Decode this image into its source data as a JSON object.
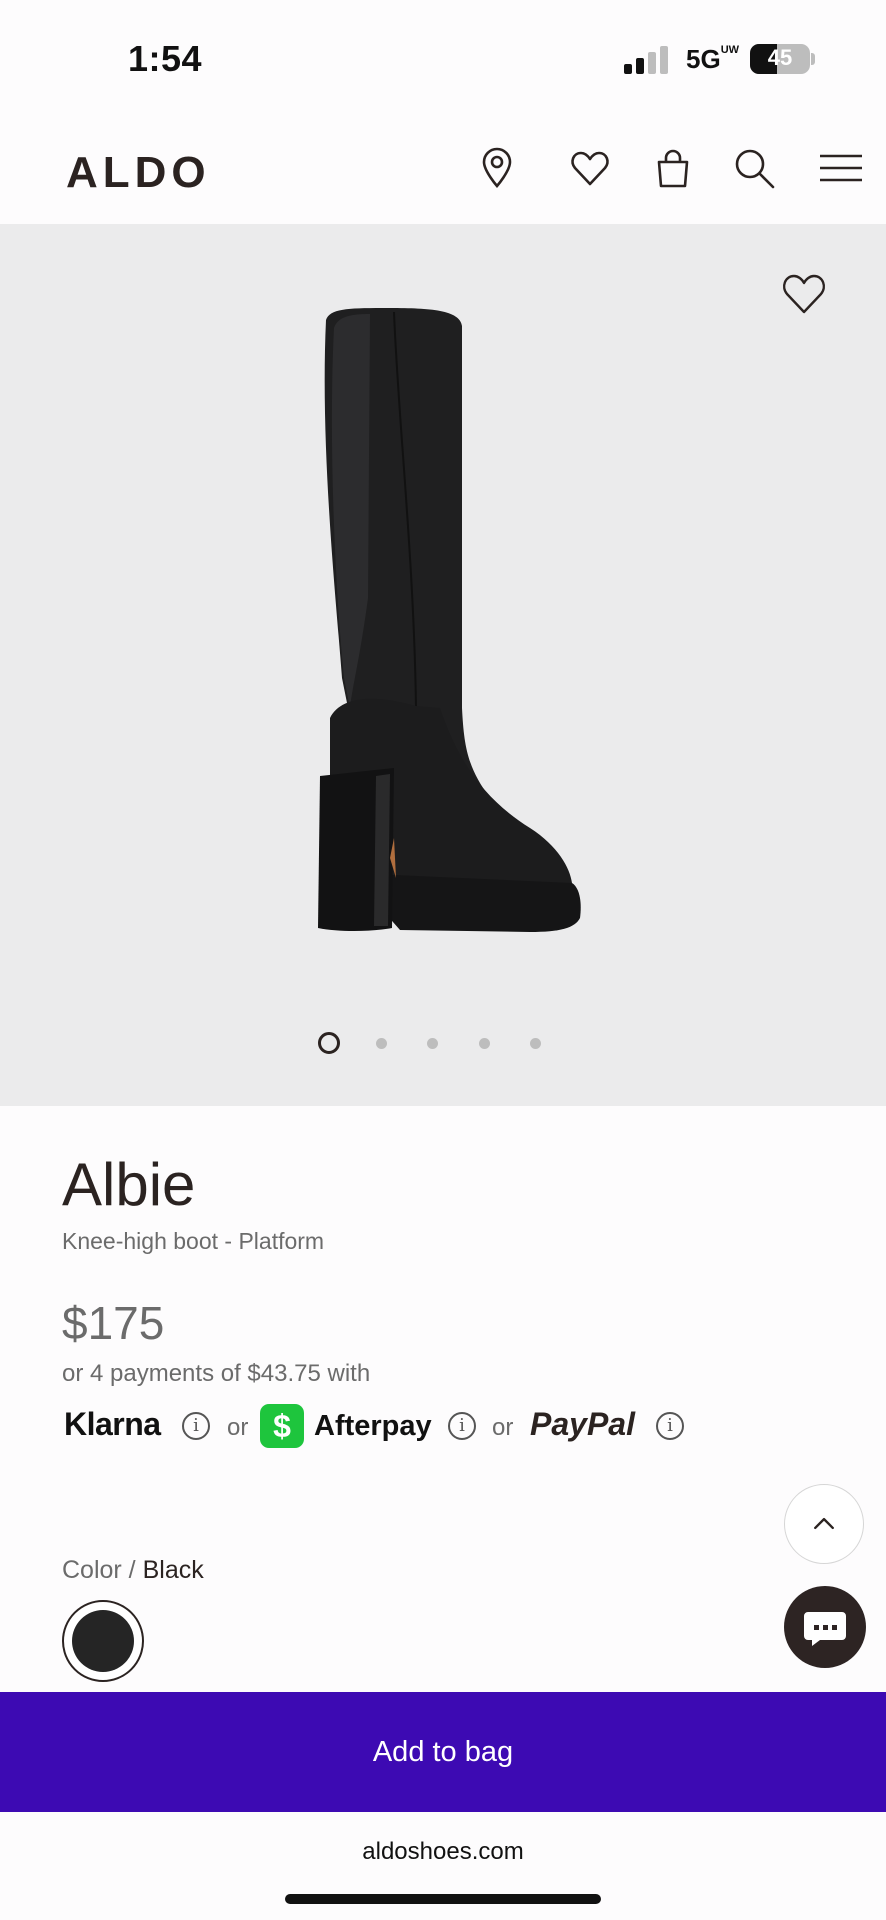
{
  "status_bar": {
    "time": "1:54",
    "network": "5G",
    "network_suffix": "UW",
    "battery": "45"
  },
  "header": {
    "logo": "ALDO",
    "icons": [
      "location-pin-icon",
      "heart-icon",
      "shopping-bag-icon",
      "search-icon",
      "menu-icon"
    ]
  },
  "gallery": {
    "image": "black knee-high platform boot",
    "image_count": 5,
    "active_index": 0
  },
  "product": {
    "name": "Albie",
    "subtitle": "Knee-high boot - Platform",
    "price": "$175",
    "installments": "or 4 payments of $43.75 with",
    "payment": {
      "klarna": "Klarna",
      "or1": "or",
      "cashapp_glyph": "$",
      "afterpay": "Afterpay",
      "or2": "or",
      "paypal": "PayPal",
      "info_glyph": "i"
    },
    "color_label": "Color /",
    "color_value": "Black"
  },
  "cta": {
    "add_to_bag": "Add to bag"
  },
  "browser": {
    "url": "aldoshoes.com"
  },
  "colors": {
    "brand_dark": "#2b2321",
    "cta_purple": "#3d0ab3",
    "cashapp_green": "#1ec53d",
    "hero_bg": "#ebebec"
  }
}
